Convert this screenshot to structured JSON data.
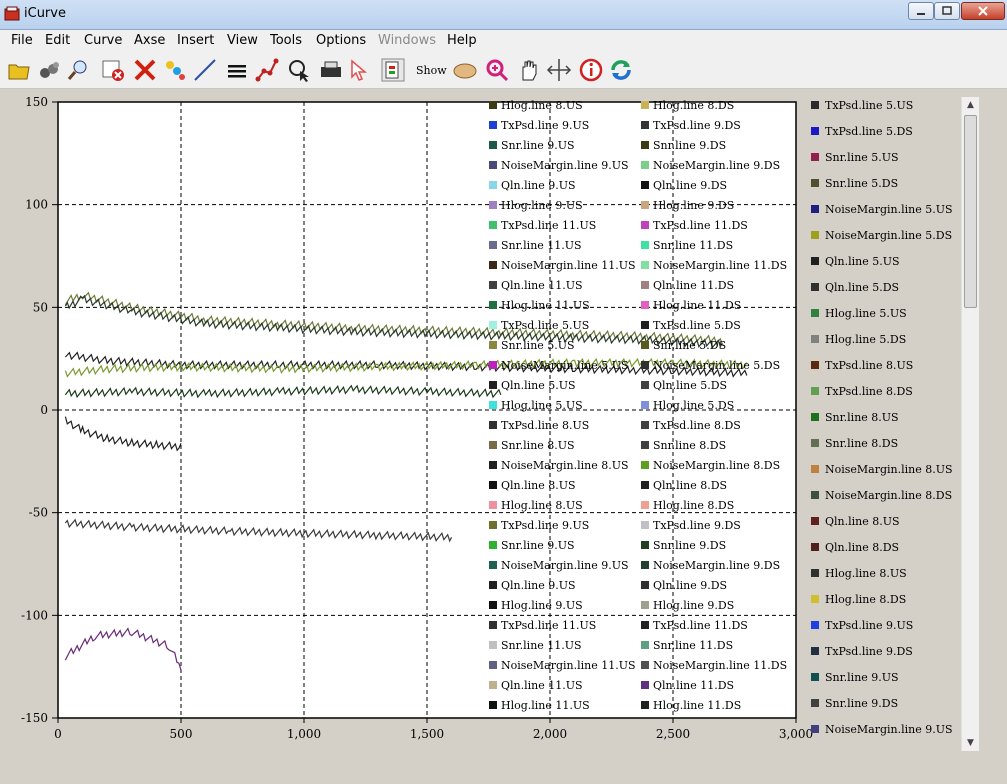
{
  "window": {
    "title": "iCurve"
  },
  "menu": [
    "File",
    "Edit",
    "Curve",
    "Axse",
    "Insert",
    "View",
    "Tools",
    "Options",
    "Windows",
    "Help"
  ],
  "menu_disabled": [
    "Windows"
  ],
  "toolbar": {
    "show_label": "Show"
  },
  "toolbar_icons": [
    "open-icon",
    "edit-icon",
    "zoom-icon",
    "delete-curve-icon",
    "clear-icon",
    "color-icon",
    "line-icon",
    "menu-lines-icon",
    "curve-nodes-icon",
    "select-icon",
    "printer-icon",
    "pointer-icon",
    "legend-icon",
    "show-icon",
    "zoom-in-icon",
    "pan-icon",
    "crosshair-icon",
    "info-icon",
    "refresh-icon"
  ],
  "chart_data": {
    "type": "line",
    "x_ticks": [
      "0",
      "500",
      "1,000",
      "1,500",
      "2,000",
      "2,500",
      "3,000"
    ],
    "y_ticks": [
      "150",
      "100",
      "50",
      "0",
      "-50",
      "-100",
      "-150"
    ],
    "xlim": [
      0,
      3000
    ],
    "ylim": [
      -150,
      150
    ],
    "grid": true,
    "legend_inner": [
      [
        "Hlog.line 8.US",
        "Hlog.line 8.DS"
      ],
      [
        "TxPsd.line 9.US",
        "TxPsd.line 9.DS"
      ],
      [
        "Snr.line 9.US",
        "Snr.line 9.DS"
      ],
      [
        "NoiseMargin.line 9.US",
        "NoiseMargin.line 9.DS"
      ],
      [
        "Qln.line 9.US",
        "Qln.line 9.DS"
      ],
      [
        "Hlog.line 9.US",
        "Hlog.line 9.DS"
      ],
      [
        "TxPsd.line 11.US",
        "TxPsd.line 11.DS"
      ],
      [
        "Snr.line 11.US",
        "Snr.line 11.DS"
      ],
      [
        "NoiseMargin.line 11.US",
        "NoiseMargin.line 11.DS"
      ],
      [
        "Qln.line 11.US",
        "Qln.line 11.DS"
      ],
      [
        "Hlog.line 11.US",
        "Hlog.line 11.DS"
      ],
      [
        "TxPsd.line 5.US",
        "TxPsd.line 5.DS"
      ],
      [
        "Snr.line 5.US",
        "Snr.line 5.DS"
      ],
      [
        "NoiseMargin.line 5.US",
        "NoiseMargin.line 5.DS"
      ],
      [
        "Qln.line 5.US",
        "Qln.line 5.DS"
      ],
      [
        "Hlog.line 5.US",
        "Hlog.line 5.DS"
      ],
      [
        "TxPsd.line 8.US",
        "TxPsd.line 8.DS"
      ],
      [
        "Snr.line 8.US",
        "Snr.line 8.DS"
      ],
      [
        "NoiseMargin.line 8.US",
        "NoiseMargin.line 8.DS"
      ],
      [
        "Qln.line 8.US",
        "Qln.line 8.DS"
      ],
      [
        "Hlog.line 8.US",
        "Hlog.line 8.DS"
      ],
      [
        "TxPsd.line 9.US",
        "TxPsd.line 9.DS"
      ],
      [
        "Snr.line 9.US",
        "Snr.line 9.DS"
      ],
      [
        "NoiseMargin.line 9.US",
        "NoiseMargin.line 9.DS"
      ],
      [
        "Qln.line 9.US",
        "Qln.line 9.DS"
      ],
      [
        "Hlog.line 9.US",
        "Hlog.line 9.DS"
      ],
      [
        "TxPsd.line 11.US",
        "TxPsd.line 11.DS"
      ],
      [
        "Snr.line 11.US",
        "Snr.line 11.DS"
      ],
      [
        "NoiseMargin.line 11.US",
        "NoiseMargin.line 11.DS"
      ],
      [
        "Qln.line 11.US",
        "Qln.line 11.DS"
      ],
      [
        "Hlog.line 11.US",
        "Hlog.line 11.DS"
      ]
    ],
    "legend_inner_colors": [
      [
        "#3a3a14",
        "#c9b15a"
      ],
      [
        "#1f3fd0",
        "#333333"
      ],
      [
        "#1d5a4a",
        "#3a3a14"
      ],
      [
        "#4a4a7a",
        "#7ad08a"
      ],
      [
        "#88d6e8",
        "#111111"
      ],
      [
        "#a080c0",
        "#c8a880"
      ],
      [
        "#40c070",
        "#c040c0"
      ],
      [
        "#6a6a8a",
        "#40e0a0"
      ],
      [
        "#3a2a1a",
        "#80e0a0"
      ],
      [
        "#404040",
        "#a08080"
      ],
      [
        "#207040",
        "#e060c0"
      ],
      [
        "#a0f0e0",
        "#202020"
      ],
      [
        "#888840",
        "#5a5a20"
      ],
      [
        "#c020c0",
        "#303030"
      ],
      [
        "#202020",
        "#404040"
      ],
      [
        "#40e0e0",
        "#8090e0"
      ],
      [
        "#303030",
        "#404040"
      ],
      [
        "#7a6a4a",
        "#404040"
      ],
      [
        "#202020",
        "#60a020"
      ],
      [
        "#111111",
        "#202020"
      ],
      [
        "#f090a0",
        "#f0a090"
      ],
      [
        "#707030",
        "#c0c0c8"
      ],
      [
        "#30b030",
        "#204020"
      ],
      [
        "#206050",
        "#204030"
      ],
      [
        "#202020",
        "#303030"
      ],
      [
        "#111111",
        "#a0a090"
      ],
      [
        "#303030",
        "#202020"
      ],
      [
        "#c0c0c0",
        "#60a080"
      ],
      [
        "#606080",
        "#505050"
      ],
      [
        "#c0b090",
        "#603080"
      ],
      [
        "#111111",
        "#202020"
      ]
    ],
    "legend_outer": [
      "TxPsd.line 5.US",
      "TxPsd.line 5.DS",
      "Snr.line 5.US",
      "Snr.line 5.DS",
      "NoiseMargin.line 5.US",
      "NoiseMargin.line 5.DS",
      "Qln.line 5.US",
      "Qln.line 5.DS",
      "Hlog.line 5.US",
      "Hlog.line 5.DS",
      "TxPsd.line 8.US",
      "TxPsd.line 8.DS",
      "Snr.line 8.US",
      "Snr.line 8.DS",
      "NoiseMargin.line 8.US",
      "NoiseMargin.line 8.DS",
      "Qln.line 8.US",
      "Qln.line 8.DS",
      "Hlog.line 8.US",
      "Hlog.line 8.DS",
      "TxPsd.line 9.US",
      "TxPsd.line 9.DS",
      "Snr.line 9.US",
      "Snr.line 9.DS",
      "NoiseMargin.line 9.US"
    ],
    "legend_outer_colors": [
      "#2a2a2a",
      "#1a1ac0",
      "#902050",
      "#505030",
      "#202080",
      "#a0a020",
      "#202020",
      "#303030",
      "#308040",
      "#808080",
      "#5a2a10",
      "#60a050",
      "#207020",
      "#607050",
      "#c08040",
      "#405040",
      "#602020",
      "#502020",
      "#303030",
      "#d0c030",
      "#2040e0",
      "#203040",
      "#105050",
      "#404040",
      "#404080"
    ],
    "series_approx": [
      {
        "name": "TxPsd.line 5.US",
        "color": "#6e7a3a",
        "points": [
          [
            30,
            53
          ],
          [
            100,
            56
          ],
          [
            300,
            50
          ],
          [
            600,
            44
          ],
          [
            900,
            42
          ],
          [
            1200,
            40
          ],
          [
            1500,
            39
          ],
          [
            1800,
            38
          ],
          [
            2100,
            37
          ],
          [
            2400,
            36
          ],
          [
            2700,
            34
          ]
        ]
      },
      {
        "name": "TxPsd.line 5.DS",
        "color": "#2a3a2a",
        "points": [
          [
            30,
            50
          ],
          [
            100,
            54
          ],
          [
            300,
            48
          ],
          [
            600,
            42
          ],
          [
            900,
            40
          ],
          [
            1200,
            38
          ],
          [
            1500,
            37
          ],
          [
            1800,
            36
          ],
          [
            2100,
            35
          ],
          [
            2400,
            34
          ],
          [
            2700,
            32
          ]
        ]
      },
      {
        "name": "Snr.line 5.US",
        "color": "#222222",
        "points": [
          [
            30,
            27
          ],
          [
            200,
            24
          ],
          [
            500,
            22
          ],
          [
            900,
            22
          ],
          [
            1300,
            22
          ],
          [
            1700,
            21
          ],
          [
            2100,
            20
          ],
          [
            2500,
            19
          ],
          [
            2800,
            18
          ]
        ]
      },
      {
        "name": "NoiseMargin.line 5.US",
        "color": "#7a9a30",
        "points": [
          [
            30,
            18
          ],
          [
            200,
            20
          ],
          [
            500,
            21
          ],
          [
            900,
            20
          ],
          [
            1300,
            21
          ],
          [
            1700,
            22
          ],
          [
            2100,
            23
          ],
          [
            2500,
            23
          ],
          [
            2800,
            22
          ]
        ]
      },
      {
        "name": "Qln.line 5.US",
        "color": "#1a3a1a",
        "points": [
          [
            30,
            8
          ],
          [
            300,
            9
          ],
          [
            600,
            8
          ],
          [
            900,
            9
          ],
          [
            1200,
            10
          ],
          [
            1500,
            9
          ],
          [
            1800,
            8
          ]
        ]
      },
      {
        "name": "Hlog.line 8.US",
        "color": "#202020",
        "points": [
          [
            30,
            -5
          ],
          [
            100,
            -10
          ],
          [
            200,
            -14
          ],
          [
            300,
            -16
          ],
          [
            400,
            -17
          ],
          [
            500,
            -18
          ]
        ]
      },
      {
        "name": "Snr.line 9.US",
        "color": "#3a3a3a",
        "points": [
          [
            30,
            -55
          ],
          [
            300,
            -57
          ],
          [
            700,
            -59
          ],
          [
            1000,
            -60
          ],
          [
            1300,
            -61
          ],
          [
            1600,
            -62
          ]
        ]
      },
      {
        "name": "Hlog.line 11.US",
        "color": "#6a2a7a",
        "points": [
          [
            30,
            -120
          ],
          [
            150,
            -110
          ],
          [
            300,
            -108
          ],
          [
            450,
            -115
          ],
          [
            500,
            -125
          ]
        ]
      }
    ]
  }
}
